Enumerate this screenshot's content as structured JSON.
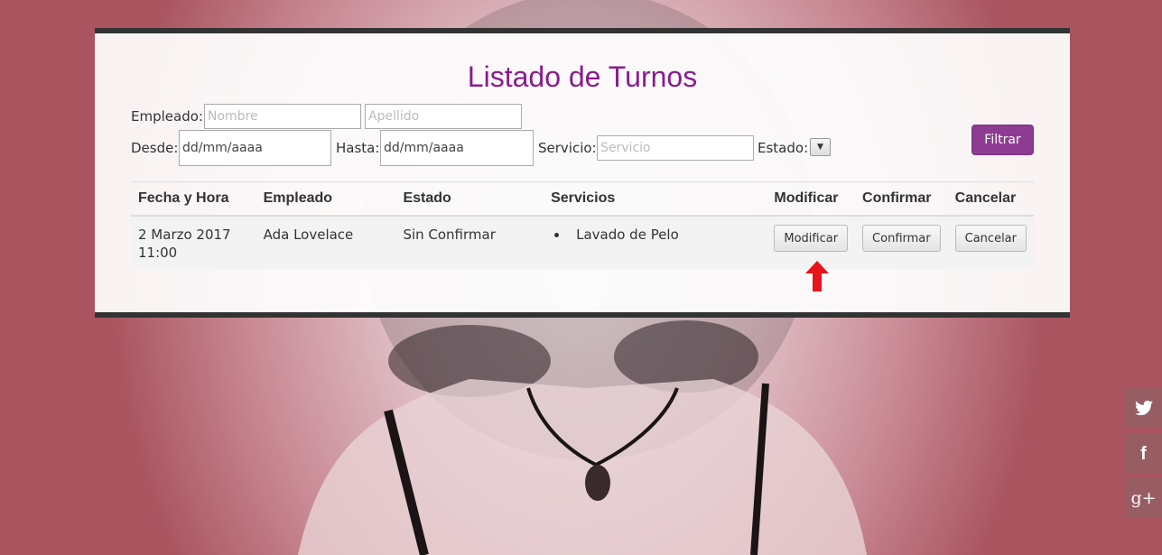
{
  "page": {
    "title": "Listado de Turnos"
  },
  "filters": {
    "empleado_label": "Empleado:",
    "nombre_placeholder": "Nombre",
    "apellido_placeholder": "Apellido",
    "desde_label": "Desde:",
    "desde_value": "dd/mm/aaaa",
    "hasta_label": "Hasta:",
    "hasta_value": "dd/mm/aaaa",
    "servicio_label": "Servicio:",
    "servicio_placeholder": "Servicio",
    "estado_label": "Estado:",
    "filtrar_label": "Filtrar"
  },
  "table": {
    "headers": [
      "Fecha y Hora",
      "Empleado",
      "Estado",
      "Servicios",
      "Modificar",
      "Confirmar",
      "Cancelar"
    ],
    "rows": [
      {
        "fecha_line1": "2 Marzo 2017",
        "fecha_line2": "11:00",
        "empleado": "Ada Lovelace",
        "estado": "Sin Confirmar",
        "servicios": [
          "Lavado de Pelo"
        ],
        "modificar": "Modificar",
        "confirmar": "Confirmar",
        "cancelar": "Cancelar"
      }
    ]
  },
  "social": [
    {
      "icon": "twitter-icon",
      "glyph": "🐦"
    },
    {
      "icon": "facebook-icon",
      "glyph": "f"
    },
    {
      "icon": "google-plus-icon",
      "glyph": "g+"
    }
  ],
  "colors": {
    "accent": "#8e3b93",
    "title": "#8a1c8f",
    "arrow": "#e8141c"
  }
}
